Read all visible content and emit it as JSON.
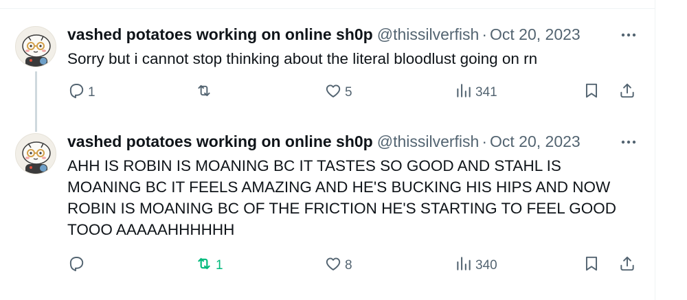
{
  "tweets": [
    {
      "name": "vashed potatoes working on online sh0p",
      "handle": "@thissilverfish",
      "separator": "·",
      "date": "Oct 20, 2023",
      "text": "Sorry but i cannot stop thinking about the literal bloodlust going on rn",
      "replies": "1",
      "reposts": "",
      "likes": "5",
      "views": "341"
    },
    {
      "name": "vashed potatoes working on online sh0p",
      "handle": "@thissilverfish",
      "separator": "·",
      "date": "Oct 20, 2023",
      "text": "AHH IS ROBIN IS MOANING BC IT TASTES SO GOOD AND STAHL IS MOANING BC IT FEELS AMAZING AND HE'S BUCKING HIS HIPS AND NOW ROBIN IS MOANING BC OF THE FRICTION HE'S STARTING TO FEEL GOOD TOOO AAAAAHHHHHH",
      "replies": "",
      "reposts": "1",
      "likes": "8",
      "views": "340"
    }
  ],
  "colors": {
    "text": "#0f1419",
    "muted": "#536471",
    "repost_active": "#00ba7c",
    "thread_line": "#cfd9de"
  }
}
